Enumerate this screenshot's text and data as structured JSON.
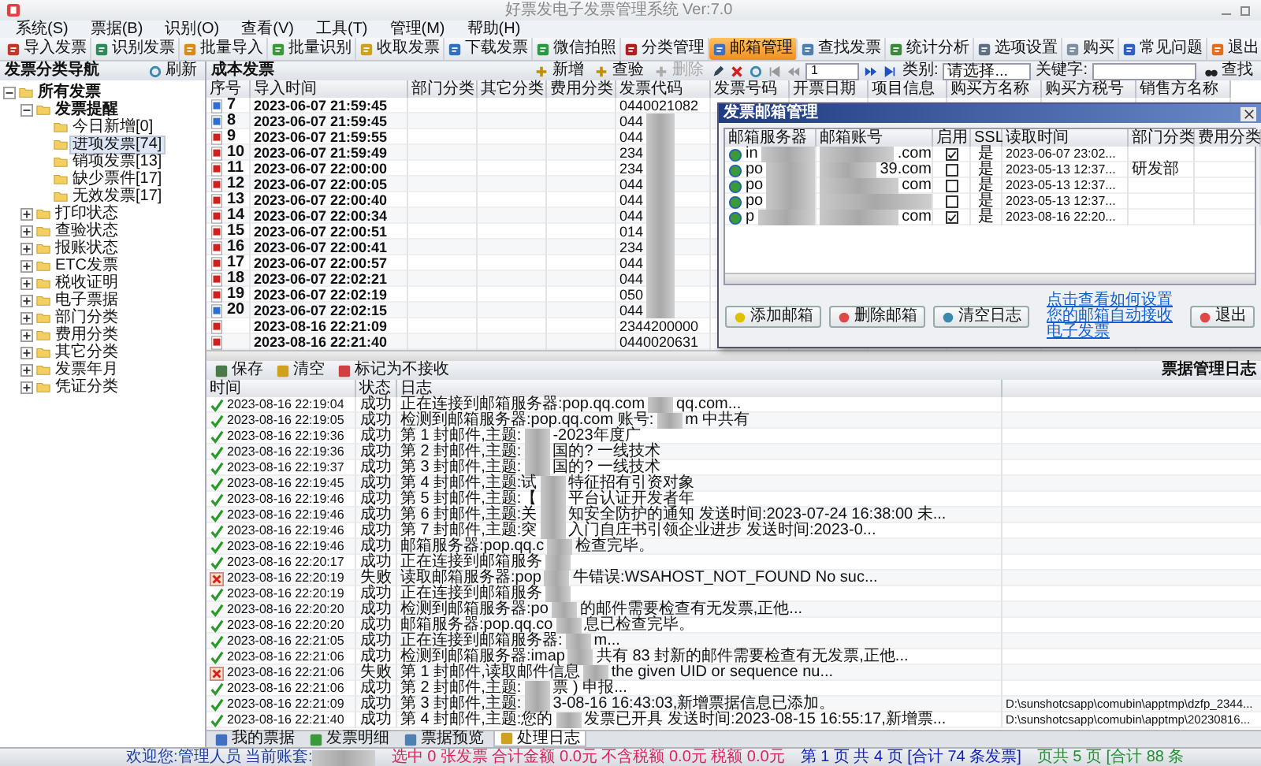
{
  "window": {
    "title": "好票发电子发票管理系统 Ver:7.0"
  },
  "menu": [
    "系统(S)",
    "票据(B)",
    "识别(O)",
    "查看(V)",
    "工具(T)",
    "管理(M)",
    "帮助(H)"
  ],
  "toolbar": [
    {
      "label": "导入发票",
      "selected": false
    },
    {
      "label": "识别发票",
      "selected": false
    },
    {
      "label": "批量导入",
      "selected": false
    },
    {
      "label": "批量识别",
      "selected": false
    },
    {
      "label": "收取发票",
      "selected": false
    },
    {
      "label": "下载发票",
      "selected": false
    },
    {
      "label": "微信拍照",
      "selected": false
    },
    {
      "label": "分类管理",
      "selected": false
    },
    {
      "label": "邮箱管理",
      "selected": true
    },
    {
      "label": "查找发票",
      "selected": false
    },
    {
      "label": "统计分析",
      "selected": false
    },
    {
      "label": "选项设置",
      "selected": false
    },
    {
      "label": "购买",
      "selected": false
    },
    {
      "label": "常见问题",
      "selected": false
    },
    {
      "label": "退出",
      "selected": false
    }
  ],
  "nav": {
    "title": "发票分类导航",
    "refresh": "刷新",
    "tree": [
      {
        "label": "所有发票",
        "expanded": true,
        "selected": false,
        "children": [
          {
            "label": "发票提醒",
            "expanded": true,
            "selected": false,
            "children": [
              {
                "label": "今日新增[0]",
                "selected": false
              },
              {
                "label": "进项发票[74]",
                "selected": true
              },
              {
                "label": "销项发票[13]",
                "selected": false
              },
              {
                "label": "缺少票件[17]",
                "selected": false
              },
              {
                "label": "无效发票[17]",
                "selected": false
              }
            ]
          },
          {
            "label": "打印状态",
            "expanded": false,
            "selected": false
          },
          {
            "label": "查验状态",
            "expanded": false,
            "selected": false
          },
          {
            "label": "报账状态",
            "expanded": false,
            "selected": false
          },
          {
            "label": "ETC发票",
            "expanded": false,
            "selected": false
          },
          {
            "label": "税收证明",
            "expanded": false,
            "selected": false
          },
          {
            "label": "电子票据",
            "expanded": false,
            "selected": false
          },
          {
            "label": "部门分类",
            "expanded": false,
            "selected": false
          },
          {
            "label": "费用分类",
            "expanded": false,
            "selected": false
          },
          {
            "label": "其它分类",
            "expanded": false,
            "selected": false
          },
          {
            "label": "发票年月",
            "expanded": false,
            "selected": false
          },
          {
            "label": "凭证分类",
            "expanded": false,
            "selected": false
          }
        ]
      }
    ]
  },
  "invoices": {
    "title": "成本发票",
    "actions": [
      {
        "label": "新增",
        "disabled": false
      },
      {
        "label": "查验",
        "disabled": false
      },
      {
        "label": "删除",
        "disabled": true
      }
    ],
    "page": "1",
    "category_label": "类别:",
    "category_value": "请选择...",
    "keyword_label": "关键字:",
    "search": "查找",
    "columns": [
      "序号",
      "导入时间",
      "部门分类",
      "其它分类",
      "费用分类",
      "发票代码",
      "发票号码",
      "开票日期",
      "项目信息",
      "购买方名称",
      "购买方税号",
      "销售方名称"
    ],
    "rows": [
      {
        "no": "7",
        "color": "#2f6fd0",
        "imported": "2023-06-07 21:59:45",
        "code": "0440021082",
        "blurred": false
      },
      {
        "no": "8",
        "color": "#2f6fd0",
        "imported": "2023-06-07 21:59:45",
        "code": "044",
        "blurred": true
      },
      {
        "no": "9",
        "color": "#d02020",
        "imported": "2023-06-07 21:59:55",
        "code": "044",
        "blurred": true
      },
      {
        "no": "10",
        "color": "#d02020",
        "imported": "2023-06-07 21:59:49",
        "code": "234",
        "blurred": true
      },
      {
        "no": "11",
        "color": "#d02020",
        "imported": "2023-06-07 22:00:00",
        "code": "234",
        "blurred": true
      },
      {
        "no": "12",
        "color": "#d02020",
        "imported": "2023-06-07 22:00:05",
        "code": "044",
        "blurred": true
      },
      {
        "no": "13",
        "color": "#d02020",
        "imported": "2023-06-07 22:00:40",
        "code": "044",
        "blurred": true
      },
      {
        "no": "14",
        "color": "#d02020",
        "imported": "2023-06-07 22:00:34",
        "code": "044",
        "blurred": true
      },
      {
        "no": "15",
        "color": "#d02020",
        "imported": "2023-06-07 22:00:51",
        "code": "014",
        "blurred": true
      },
      {
        "no": "16",
        "color": "#d02020",
        "imported": "2023-06-07 22:00:41",
        "code": "234",
        "blurred": true
      },
      {
        "no": "17",
        "color": "#d02020",
        "imported": "2023-06-07 22:00:57",
        "code": "044",
        "blurred": true
      },
      {
        "no": "18",
        "color": "#d02020",
        "imported": "2023-06-07 22:02:21",
        "code": "044",
        "blurred": true
      },
      {
        "no": "19",
        "color": "#d02020",
        "imported": "2023-06-07 22:02:19",
        "code": "050",
        "blurred": true
      },
      {
        "no": "20",
        "color": "#2f6fd0",
        "imported": "2023-06-07 22:02:15",
        "code": "044",
        "blurred": true
      },
      {
        "color": "#d02020",
        "imported": "2023-08-16 22:21:09",
        "code": "2344200000",
        "blurred": false
      },
      {
        "color": "#d02020",
        "imported": "2023-08-16 22:21:40",
        "code": "0440020631",
        "blurred": false
      }
    ]
  },
  "dialog": {
    "title": "发票邮箱管理",
    "columns": [
      "邮箱服务器",
      "邮箱账号",
      "启用",
      "SSL",
      "读取时间",
      "部门分类",
      "费用分类"
    ],
    "rows": [
      {
        "server": "in",
        "account": ".com",
        "enabled": true,
        "ssl": "是",
        "read_time": "2023-06-07 23:02..."
      },
      {
        "server": "po",
        "account": "39.com",
        "enabled": false,
        "ssl": "是",
        "read_time": "2023-05-13 12:37...",
        "department": "研发部"
      },
      {
        "server": "po",
        "account": "com",
        "enabled": false,
        "ssl": "是",
        "read_time": "2023-05-13 12:37..."
      },
      {
        "server": "po",
        "enabled": false,
        "ssl": "是",
        "read_time": "2023-05-13 12:37..."
      },
      {
        "server": "p",
        "account": "com",
        "enabled": true,
        "ssl": "是",
        "read_time": "2023-08-16 22:20..."
      }
    ],
    "buttons": [
      "添加邮箱",
      "删除邮箱",
      "清空日志"
    ],
    "link": "点击查看如何设置您的邮箱自动接收电子发票",
    "exit": "退出"
  },
  "log": {
    "actions": [
      "保存",
      "清空",
      "标记为不接收"
    ],
    "title": "票据管理日志",
    "columns": [
      "时间",
      "状态",
      "日志"
    ],
    "rows": [
      {
        "time": "2023-08-16 22:19:04",
        "kind": "success",
        "status": "成功",
        "text": "正在连接到邮箱服务器:pop.qq.com",
        "text_end": "qq.com...",
        "blurred": true
      },
      {
        "time": "2023-08-16 22:19:05",
        "kind": "success",
        "status": "成功",
        "text": "检测到邮箱服务器:pop.qq.com 账号:",
        "text_end": "m 中共有",
        "blurred": true
      },
      {
        "time": "2023-08-16 22:19:36",
        "kind": "success",
        "status": "成功",
        "text": "第 1 封邮件,主题:",
        "text_end": "-2023年度广",
        "blurred": true
      },
      {
        "time": "2023-08-16 22:19:36",
        "kind": "success",
        "status": "成功",
        "text": "第 2 封邮件,主题:",
        "text_end": "国的? 一线技术",
        "blurred": true
      },
      {
        "time": "2023-08-16 22:19:37",
        "kind": "success",
        "status": "成功",
        "text": "第 3 封邮件,主题:",
        "text_end": "国的? 一线技术",
        "blurred": true
      },
      {
        "time": "2023-08-16 22:19:45",
        "kind": "success",
        "status": "成功",
        "text": "第 4 封邮件,主题:试",
        "text_end": "特征招有引资对象",
        "blurred": true
      },
      {
        "time": "2023-08-16 22:19:46",
        "kind": "success",
        "status": "成功",
        "text": "第 5 封邮件,主题:【",
        "text_end": "平台认证开发者年",
        "blurred": true
      },
      {
        "time": "2023-08-16 22:19:46",
        "kind": "success",
        "status": "成功",
        "text": "第 6 封邮件,主题:关",
        "text_end": "知安全防护的通知 发送时间:2023-07-24 16:38:00 未...",
        "blurred": true
      },
      {
        "time": "2023-08-16 22:19:46",
        "kind": "success",
        "status": "成功",
        "text": "第 7 封邮件,主题:突",
        "text_end": "入门自庄书引领企业进步 发送时间:2023-0...",
        "blurred": true
      },
      {
        "time": "2023-08-16 22:19:46",
        "kind": "success",
        "status": "成功",
        "text": "邮箱服务器:pop.qq.c",
        "text_end": "检查完毕。",
        "blurred": true
      },
      {
        "time": "2023-08-16 22:20:17",
        "kind": "success",
        "status": "成功",
        "text": "正在连接到邮箱服务",
        "blurred": true
      },
      {
        "time": "2023-08-16 22:20:19",
        "kind": "failure",
        "status": "失败",
        "text": "读取邮箱服务器:pop",
        "text_end": "牛错误:WSAHOST_NOT_FOUND No suc...",
        "blurred": true
      },
      {
        "time": "2023-08-16 22:20:19",
        "kind": "success",
        "status": "成功",
        "text": "正在连接到邮箱服务",
        "blurred": true
      },
      {
        "time": "2023-08-16 22:20:20",
        "kind": "success",
        "status": "成功",
        "text": "检测到邮箱服务器:po",
        "text_end": "的邮件需要检查有无发票,正他...",
        "blurred": true
      },
      {
        "time": "2023-08-16 22:20:20",
        "kind": "success",
        "status": "成功",
        "text": "邮箱服务器:pop.qq.co",
        "text_end": "息已检查完毕。",
        "blurred": true
      },
      {
        "time": "2023-08-16 22:21:05",
        "kind": "success",
        "status": "成功",
        "text": "正在连接到邮箱服务器:",
        "text_end": "m...",
        "blurred": true
      },
      {
        "time": "2023-08-16 22:21:06",
        "kind": "success",
        "status": "成功",
        "text": "检测到邮箱服务器:imap",
        "text_end": "共有 83 封新的邮件需要检查有无发票,正他...",
        "blurred": true
      },
      {
        "time": "2023-08-16 22:21:06",
        "kind": "failure",
        "status": "失败",
        "text": "第 1 封邮件,读取邮件信息",
        "text_end": "the given UID or sequence nu...",
        "blurred": true
      },
      {
        "time": "2023-08-16 22:21:06",
        "kind": "success",
        "status": "成功",
        "text": "第 2 封邮件,主题:",
        "text_end": "票 ) 申报...",
        "blurred": true
      },
      {
        "time": "2023-08-16 22:21:09",
        "kind": "success",
        "status": "成功",
        "text": "第 3 封邮件,主题:",
        "text_end": "3-08-16 16:43:03,新增票据信息已添加。",
        "path": "D:\\sunshotcsapp\\comubin\\apptmp\\dzfp_2344...",
        "blurred": true
      },
      {
        "time": "2023-08-16 22:21:40",
        "kind": "success",
        "status": "成功",
        "text": "第 4 封邮件,主题:您的",
        "text_end": "发票已开具 发送时间:2023-08-15 16:55:17,新增票...",
        "path": "D:\\sunshotcsapp\\comubin\\apptmp\\20230816...",
        "blurred": true
      }
    ]
  },
  "tabs": [
    {
      "label": "我的票据",
      "selected": false
    },
    {
      "label": "发票明细",
      "selected": false
    },
    {
      "label": "票据预览",
      "selected": false
    },
    {
      "label": "处理日志",
      "selected": true
    }
  ],
  "status_bar": {
    "welcome": "欢迎您:管理人员 当前账套:",
    "totals": "选中 0 张发票 合计金额 0.0元 不含税额 0.0元 税额 0.0元",
    "page_info": "第 1 页 共 4 页 [合计 74 条发票]",
    "page_info_2": "页共 5 页 [合计 88 条"
  }
}
